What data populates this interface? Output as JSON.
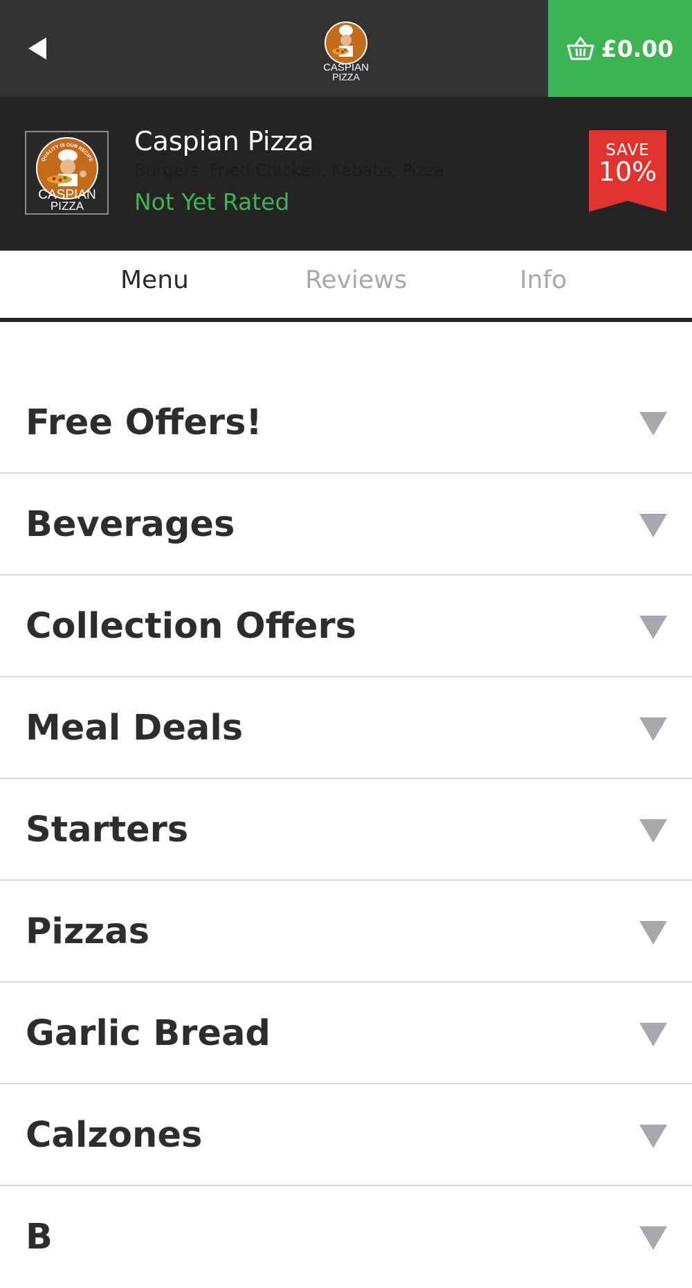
{
  "topbar": {
    "back_icon": "back-arrow-icon",
    "logo_alt": "Caspian Pizza logo",
    "basket": {
      "icon": "basket-icon",
      "total": "£0.00",
      "color": "#3db453"
    }
  },
  "restaurant": {
    "name": "Caspian Pizza",
    "cuisine": "Burgers, Fried Chicken, Kebabs, Pizza",
    "rating": "Not Yet Rated",
    "logo_text_top": "CASPIAN",
    "logo_text_bottom": "PIZZA",
    "logo_arc_text": "QUALITY IS OUR RECIPE",
    "save_badge": {
      "label": "SAVE",
      "value": "10%",
      "color": "#e0332f"
    }
  },
  "tabs": [
    {
      "label": "Menu",
      "active": true
    },
    {
      "label": "Reviews",
      "active": false
    },
    {
      "label": "Info",
      "active": false
    }
  ],
  "categories": [
    {
      "label": "Free Offers!"
    },
    {
      "label": "Beverages"
    },
    {
      "label": "Collection Offers"
    },
    {
      "label": "Meal Deals"
    },
    {
      "label": "Starters"
    },
    {
      "label": "Pizzas"
    },
    {
      "label": "Garlic Bread"
    },
    {
      "label": "Calzones"
    },
    {
      "label": "B"
    }
  ],
  "colors": {
    "topbar": "#343233",
    "header": "#252324",
    "accent_green": "#3db453",
    "badge_red": "#e0332f",
    "arrow_grey": "#a6a8ab"
  }
}
